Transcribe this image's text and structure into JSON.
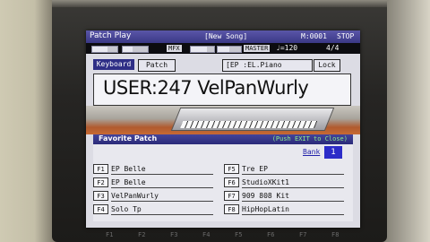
{
  "header": {
    "title": "Patch Play",
    "song": "[New Song]",
    "measure": "M:0001",
    "transport": "STOP"
  },
  "status_bar": {
    "mfx_label": "MFX",
    "master_label": "MASTER",
    "tempo": "♩=120",
    "beat": "4/4"
  },
  "tabs": {
    "keyboard": "Keyboard",
    "patch": "Patch"
  },
  "category": "[EP :EL.Piano",
  "lock_label": "Lock",
  "patch_name": "USER:247 VelPanWurly",
  "favorite": {
    "title": "Favorite Patch",
    "hint": "(Push EXIT to Close)",
    "bank_label": "Bank",
    "bank_value": "1",
    "slots": [
      {
        "key": "F1",
        "name": "EP Belle"
      },
      {
        "key": "F2",
        "name": "EP Belle"
      },
      {
        "key": "F3",
        "name": "VelPanWurly"
      },
      {
        "key": "F4",
        "name": "Solo Tp"
      },
      {
        "key": "F5",
        "name": "Tre EP"
      },
      {
        "key": "F6",
        "name": "StudioXKit1"
      },
      {
        "key": "F7",
        "name": "909 808 Kit"
      },
      {
        "key": "F8",
        "name": "HipHopLatin"
      }
    ]
  },
  "soft_keys": [
    "F1",
    "F2",
    "F3",
    "F4",
    "F5",
    "F6",
    "F7",
    "F8"
  ],
  "colors": {
    "header_bg": "#3a3886",
    "selection_bg": "#2e2e86",
    "bank_bg": "#2c2cc8",
    "hint_text": "#8ef08e"
  }
}
